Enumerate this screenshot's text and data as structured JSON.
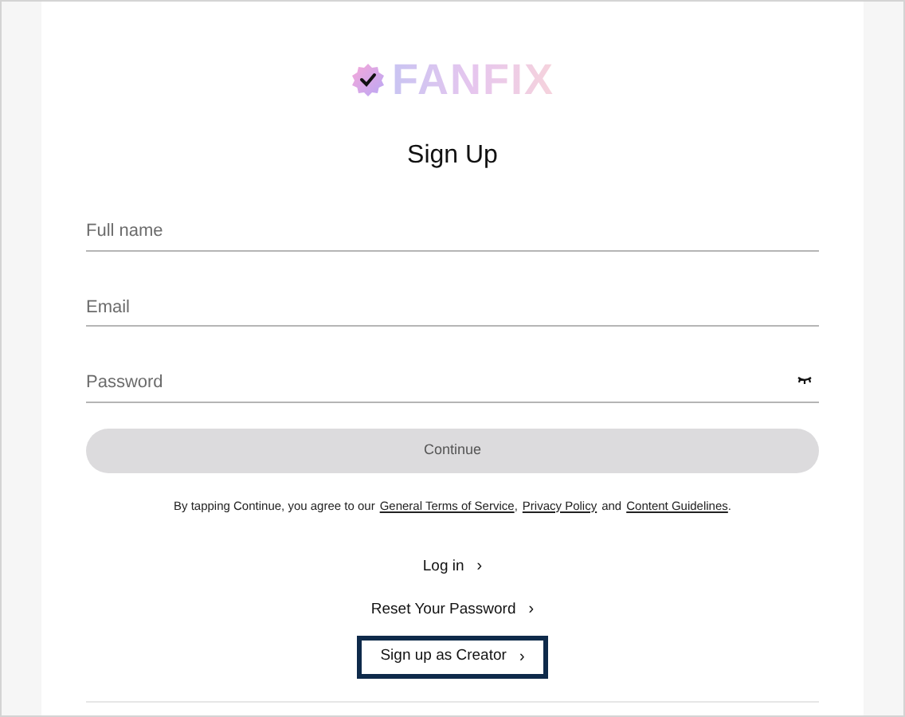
{
  "logo": {
    "text": "FANFIX"
  },
  "title": "Sign Up",
  "fields": [
    {
      "placeholder": "Full name",
      "kind": "text"
    },
    {
      "placeholder": "Email",
      "kind": "text"
    },
    {
      "placeholder": "Password",
      "kind": "password"
    }
  ],
  "continue_button": {
    "label": "Continue",
    "disabled": true
  },
  "terms": {
    "text": "By tapping Continue, you agree to our",
    "links": [
      "General Terms of Service",
      "Privacy Policy",
      "Content Guidelines"
    ],
    "separator": ",",
    "conjunction": "and",
    "end": "."
  },
  "links": [
    {
      "label": "Log in",
      "arrow": "›",
      "focused": false
    },
    {
      "label": "Reset Your Password",
      "arrow": "›",
      "focused": false
    },
    {
      "label": "Sign up as Creator",
      "arrow": "›",
      "focused": true
    }
  ]
}
